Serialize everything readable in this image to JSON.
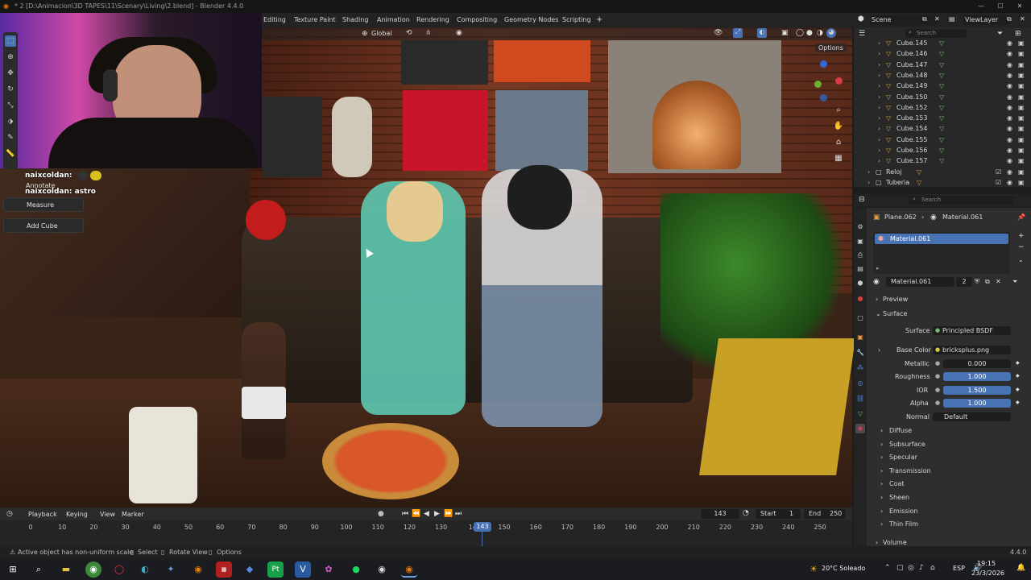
{
  "window": {
    "title": "* 2 [D:\\Animacion\\3D TAPES\\11\\Scenary\\Living\\2.blend] - Blender 4.4.0"
  },
  "workspace_tabs": [
    "Editing",
    "Texture Paint",
    "Shading",
    "Animation",
    "Rendering",
    "Compositing",
    "Geometry Nodes",
    "Scripting",
    "+"
  ],
  "viewport_header": {
    "orientation": "Global",
    "options_label": "Options"
  },
  "chat": {
    "line1": "naixcoldan:",
    "line2": "naixcoldan: astro"
  },
  "tool_popups": {
    "annotate": "Annotate",
    "measure": "Measure",
    "add_cube": "Add Cube"
  },
  "outliner": {
    "scene_label": "Scene",
    "view_layer_label": "ViewLayer",
    "search_placeholder": "Search",
    "rows": [
      {
        "name": "Cube.145"
      },
      {
        "name": "Cube.146"
      },
      {
        "name": "Cube.147"
      },
      {
        "name": "Cube.148"
      },
      {
        "name": "Cube.149"
      },
      {
        "name": "Cube.150"
      },
      {
        "name": "Cube.152"
      },
      {
        "name": "Cube.153"
      },
      {
        "name": "Cube.154"
      },
      {
        "name": "Cube.155"
      },
      {
        "name": "Cube.156"
      },
      {
        "name": "Cube.157"
      },
      {
        "name": "Reloj"
      },
      {
        "name": "Tuberia"
      }
    ]
  },
  "properties": {
    "search_placeholder": "Search",
    "breadcrumb_object": "Plane.062",
    "breadcrumb_material": "Material.061",
    "slot_name": "Material.061",
    "datablock_name": "Material.061",
    "user_count": "2",
    "preview_label": "Preview",
    "surface_label": "Surface",
    "surface_shader_label": "Surface",
    "surface_shader_value": "Principled BSDF",
    "base_color_label": "Base Color",
    "base_color_value": "bricksplus.png",
    "metallic_label": "Metallic",
    "metallic_value": "0.000",
    "roughness_label": "Roughness",
    "roughness_value": "1.000",
    "ior_label": "IOR",
    "ior_value": "1.500",
    "alpha_label": "Alpha",
    "alpha_value": "1.000",
    "normal_label": "Normal",
    "normal_value": "Default",
    "subpanels": [
      "Diffuse",
      "Subsurface",
      "Specular",
      "Transmission",
      "Coat",
      "Sheen",
      "Emission",
      "Thin Film"
    ],
    "volume_label": "Volume"
  },
  "timeline": {
    "menu": [
      "Playback",
      "Keying",
      "View",
      "Marker"
    ],
    "current_frame": "143",
    "start_label": "Start",
    "start_value": "1",
    "end_label": "End",
    "end_value": "250",
    "ticks": [
      "0",
      "10",
      "20",
      "30",
      "40",
      "50",
      "60",
      "70",
      "80",
      "90",
      "100",
      "110",
      "120",
      "130",
      "14",
      "150",
      "160",
      "170",
      "180",
      "190",
      "200",
      "210",
      "220",
      "230",
      "240",
      "250"
    ],
    "playhead": "143"
  },
  "status_bar": {
    "message": "Active object has non-uniform scale",
    "select": "Select",
    "rotate_view": "Rotate View",
    "options": "Options",
    "version": "4.4.0"
  },
  "taskbar": {
    "weather": "20°C  Soleado",
    "language": "ESP",
    "time": "19:15",
    "date": "23/3/2026"
  },
  "colors": {
    "accent_blue": "#4772b3",
    "object_orange": "#e89a3c",
    "modifier_green": "#6ec06e"
  }
}
